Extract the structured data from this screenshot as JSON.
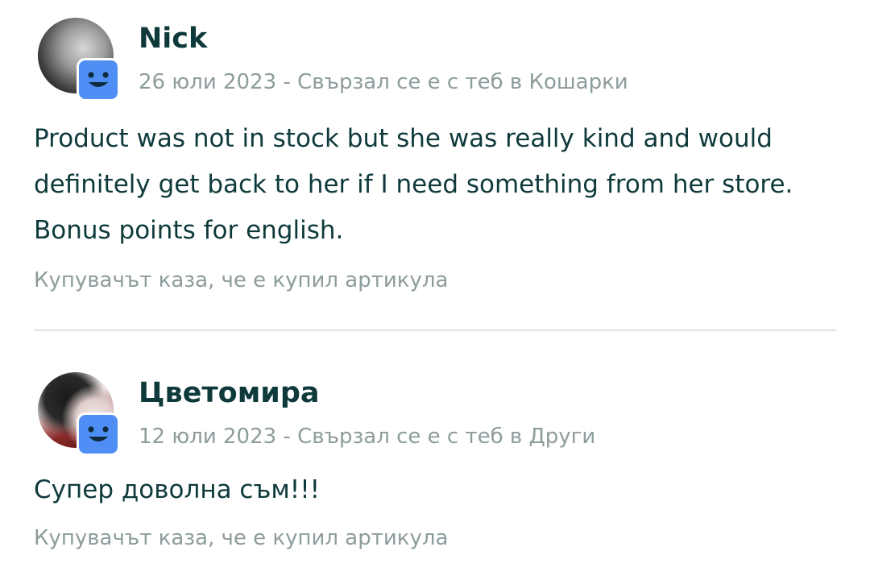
{
  "reviews": [
    {
      "name": "Nick",
      "meta": "26 юли 2023 - Свързал се е с теб в Кошарки",
      "text": "Product was not in stock but she was really kind and would definitely get back to her if I need something from her store. Bonus points for english.",
      "purchase_note": "Купувачът каза, че е купил артикула",
      "avatar_icon": "user-photo",
      "badge_icon": "smiley-badge-icon"
    },
    {
      "name": "Цветомира",
      "meta": "12 юли 2023 - Свързал се е с теб в Други",
      "text": "Супер доволна съм!!!",
      "purchase_note": "Купувачът каза, че е купил артикула",
      "avatar_icon": "user-photo",
      "badge_icon": "smiley-badge-icon"
    }
  ],
  "colors": {
    "text_primary": "#0f3a3c",
    "text_secondary": "#8d9c9c",
    "badge": "#4f8ff5",
    "divider": "#dde3e3"
  }
}
